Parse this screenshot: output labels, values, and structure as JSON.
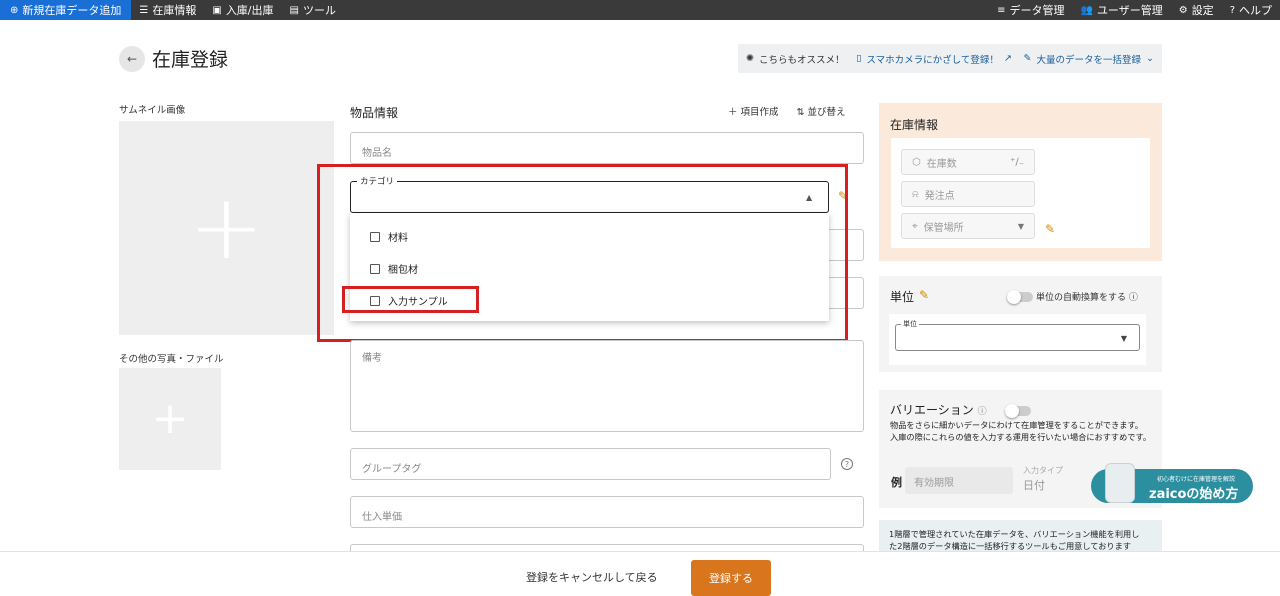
{
  "topnav": {
    "new_item": "新規在庫データ追加",
    "inventory": "在庫情報",
    "inout": "入庫/出庫",
    "tools": "ツール",
    "data_mgmt": "データ管理",
    "user_mgmt": "ユーザー管理",
    "settings": "設定",
    "help": "ヘルプ"
  },
  "header": {
    "title": "在庫登録",
    "recommend": "こちらもオススメ！",
    "camera_link": "スマホカメラにかざして登録！",
    "bulk_link": "大量のデータを一括登録"
  },
  "media": {
    "thumbnail_label": "サムネイル画像",
    "other_label": "その他の写真・ファイル"
  },
  "form": {
    "section_title": "物品情報",
    "add_field": "項目作成",
    "sort": "並び替え",
    "name_placeholder": "物品名",
    "category_label": "カテゴリ",
    "category_options": [
      "材料",
      "梱包材",
      "入力サンプル"
    ],
    "memo_placeholder": "備考",
    "group_tag_placeholder": "グループタグ",
    "price_placeholder": "仕入単価"
  },
  "stock": {
    "title": "在庫情報",
    "quantity": "在庫数",
    "reorder_point": "発注点",
    "location": "保管場所"
  },
  "unit": {
    "title": "単位",
    "auto_convert": "単位の自動換算をする",
    "select_label": "単位"
  },
  "variation": {
    "title": "バリエーション",
    "desc1": "物品をさらに細かいデータにわけて在庫管理をすることができます。",
    "desc2": "入庫の際にこれらの値を入力する運用を行いたい場合におすすめです。",
    "example": "例",
    "example_value": "有効期限",
    "input_type_label": "入力タイプ",
    "input_type_value": "日付"
  },
  "badge": {
    "sub": "初心者むけに在庫管理を解説",
    "main": "zaicoの始め方"
  },
  "notice": {
    "line1": "1階層で管理されていた在庫データを、バリエーション機能を利用し",
    "line2": "た2階層のデータ構造に一括移行するツールもご用意しております"
  },
  "footer": {
    "cancel": "登録をキャンセルして戻る",
    "submit": "登録する"
  }
}
